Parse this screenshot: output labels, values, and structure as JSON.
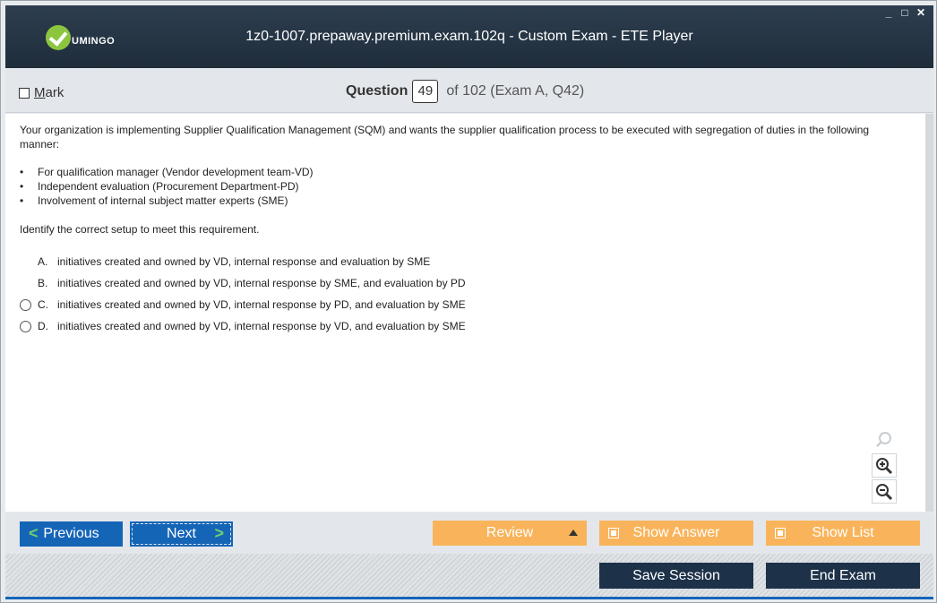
{
  "window": {
    "title": "1z0-1007.prepaway.premium.exam.102q - Custom Exam - ETE Player",
    "logo_text": "UMINGO",
    "controls": [
      "_",
      "□",
      "✕"
    ]
  },
  "question_bar": {
    "mark_label_first": "M",
    "mark_label_rest": "ark",
    "question_label": "Question",
    "question_number": "49",
    "of_text": "of 102 (Exam A, Q42)"
  },
  "question": {
    "text": "Your organization is implementing Supplier Qualification Management (SQM) and wants the supplier qualification process to be executed with segregation of duties in the following manner:",
    "bullets": [
      "For qualification manager (Vendor development team-VD)",
      "Independent evaluation (Procurement Department-PD)",
      "Involvement of internal subject matter experts (SME)"
    ],
    "instruction": "Identify the correct setup to meet this requirement.",
    "options": [
      {
        "letter": "A.",
        "text": "initiatives created and owned by VD, internal response and evaluation by SME"
      },
      {
        "letter": "B.",
        "text": "initiatives created and owned by VD, internal response by SME, and evaluation by PD"
      },
      {
        "letter": "C.",
        "text": "initiatives created and owned by VD, internal response by PD, and evaluation by SME"
      },
      {
        "letter": "D.",
        "text": "initiatives created and owned by VD, internal response by VD, and evaluation by SME"
      }
    ]
  },
  "nav": {
    "previous": "Previous",
    "next": "Next",
    "review": "Review",
    "show_answer": "Show Answer",
    "show_list": "Show List"
  },
  "footer": {
    "save_session": "Save Session",
    "end_exam": "End Exam"
  },
  "colors": {
    "title_bg": "#1f2d3b",
    "nav_blue": "#1565b7",
    "orange": "#f9b45b",
    "dark_button": "#1d3149"
  }
}
